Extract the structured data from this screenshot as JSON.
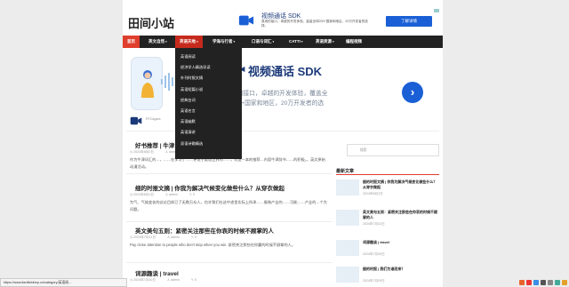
{
  "site": {
    "title": "田间小站"
  },
  "header_ad": {
    "title": "视频通话 SDK",
    "desc": "易用的接口，卓越的开发体验，量量全球200+国家和地区，20万开发者的选择。",
    "button": "了解详情"
  },
  "nav": {
    "items": [
      {
        "label": "首页"
      },
      {
        "label": "英文自然",
        "caret": "▾"
      },
      {
        "label": "英语天地",
        "caret": "▾"
      },
      {
        "label": "学海与行者",
        "caret": "▾"
      },
      {
        "label": "口语与词汇",
        "caret": "▾"
      },
      {
        "label": "CATTI",
        "caret": "▾"
      },
      {
        "label": "英语资源",
        "caret": "▾"
      },
      {
        "label": "编程视频"
      }
    ]
  },
  "dropdown": {
    "items": [
      "英语阅读",
      "经济学人精选导读",
      "外刊时报文摘",
      "英语短篇小说",
      "经典台词",
      "英语名言",
      "英语幽默",
      "英语演讲",
      "双语诗歌精选"
    ]
  },
  "banner": {
    "title": "视频通话 SDK",
    "desc": "易用的接口，卓越的开发体验，覆盖全球200+国家和地区，20万开发者的选择。",
    "small": "RTCAgora",
    "arrow": "›"
  },
  "posts": [
    {
      "title": "好书推荐 | 牛津…的……迎接活动",
      "date": "2024年8月2日",
      "author": "admin",
      "comments": "0",
      "excerpt": "作为牛津词汇的…，……在学习了……更现于英语世界的……，对这一本的推荐…内容牛津辞书……的积极。，英文原始动漫活动。"
    },
    {
      "title": "细的时报文摘 | 你我为解决气候变化做些什么？从穿衣做起",
      "date": "2024年8月1日",
      "author": "admin",
      "comments": "0",
      "excerpt": "为气、气候变化的议论目前已了无数万众人，也许我们在这中途里实际上所承……服装产业的……可能……产业的…个大问题。"
    },
    {
      "title": "英文美句五则：紧密关注那些在你哀的时候不顾掌的人",
      "date": "2024年7月31日",
      "author": "admin",
      "comments": "0",
      "excerpt": "Pay close attention to people who don't stop when you win. 紧密关注那些在你赢的时候不顾掌的人。"
    },
    {
      "title": "词源趣谈 | travel",
      "date": "2024年7月30日",
      "author": "admin",
      "comments": "0",
      "excerpt": ""
    }
  ],
  "sidebar": {
    "search_placeholder": "搜索",
    "heading": "最新文章",
    "items": [
      {
        "title": "细的时报文摘 | 你我为解决气候变化做些什么？从穿衣做起",
        "date": "2024年8月1日"
      },
      {
        "title": "英文美句五则：紧密关注那些在你哀的时候不顾掌的人",
        "date": "2024年7月31日"
      },
      {
        "title": "词源趣谈 | travel",
        "date": "2024年7月30日"
      },
      {
        "title": "细的时报 | 我们为谁而来？",
        "date": "2024年7月29日"
      }
    ]
  },
  "statusbar": {
    "url": "https://www.tianfieldnep.cn/category/英语阅…"
  },
  "icons": {
    "calendar": "calendar-icon",
    "author": "user-icon",
    "comment": "comment-icon",
    "search": "search-icon"
  }
}
